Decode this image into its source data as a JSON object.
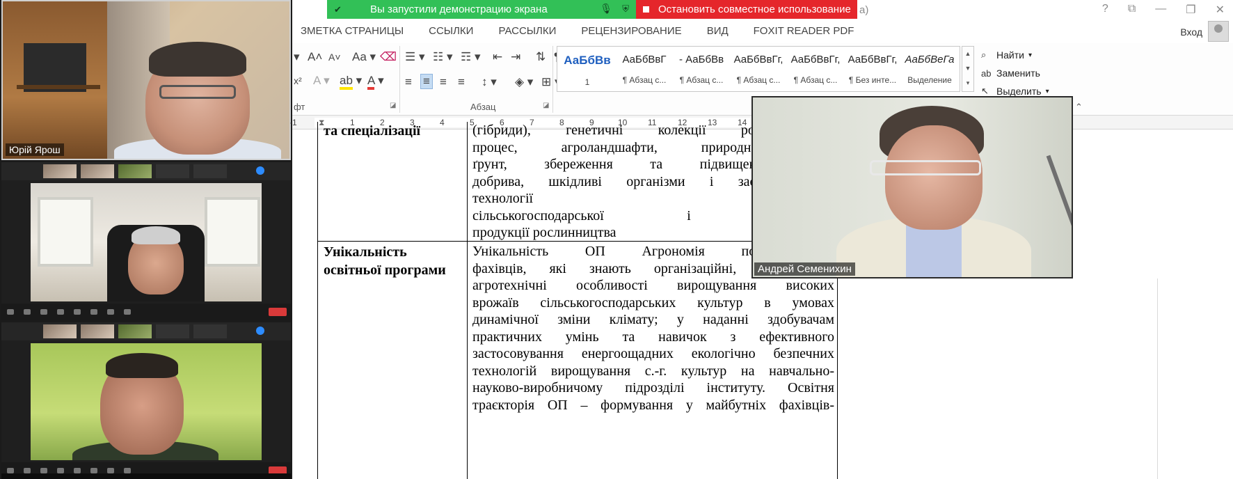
{
  "participants": {
    "tile1_name": "Юрій Ярош",
    "tile4_name": "Андрей Семенихин"
  },
  "share_bar": {
    "status": "Вы запустили демонстрацию экрана",
    "stop": "Остановить совместное использование",
    "title_fragment": "a)"
  },
  "window_controls": [
    "?",
    "⧉",
    "—",
    "❐",
    "✕"
  ],
  "tabs": [
    "ЗМЕТКА СТРАНИЦЫ",
    "ССЫЛКИ",
    "РАССЫЛКИ",
    "РЕЦЕНЗИРОВАНИЕ",
    "ВИД",
    "FOXIT READER PDF"
  ],
  "account": {
    "login": "Вход"
  },
  "ribbon": {
    "font_group_label": "фт",
    "paragraph_group_label": "Абзац",
    "styles_group_label": "С",
    "aa_label": "Aa",
    "pilcrow": "¶",
    "styles": [
      {
        "sample": "АаБбВв",
        "name": "1"
      },
      {
        "sample": "АаБбВвГ",
        "name": "¶ Абзац с..."
      },
      {
        "sample": "- АаБбВв",
        "name": "¶ Абзац с..."
      },
      {
        "sample": "АаБбВвГг,",
        "name": "¶ Абзац с..."
      },
      {
        "sample": "АаБбВвГг,",
        "name": "¶ Абзац с..."
      },
      {
        "sample": "АаБбВвГг,",
        "name": "¶ Без инте..."
      },
      {
        "sample": "АаБбВеГа",
        "name": "Выделение"
      }
    ],
    "editing": {
      "find": "Найти",
      "replace": "Заменить",
      "select": "Выделить"
    }
  },
  "ruler": [
    "1",
    "1",
    "2",
    "3",
    "4",
    "5",
    "6",
    "7",
    "8",
    "9",
    "10",
    "11",
    "12",
    "13",
    "14"
  ],
  "document": {
    "row1_head": "та спеціалізації",
    "row1_lines": [
      "(гібриди), генетичні колекції рослин, се",
      "процес, агроландшафти, природні кормо",
      "ґрунт, збереження та підвищення його",
      "добрива, шкідливі організми і засоби захис",
      "технології виробництва,",
      "сільськогосподарської і первинної",
      "продукції рослинництва"
    ],
    "row2_head_1": "Унікальність",
    "row2_head_2": "освітньої програми",
    "row2_lines": [
      "Унікальність ОП Агрономія полягає: у",
      "фахівців, які знають організаційні, технологічні",
      "агротехнічні особливості вирощування високих",
      "врожаїв сільськогосподарських культур в умовах",
      "динамічної зміни клімату; у наданні здобувачам",
      "практичних умінь та навичок з ефективного",
      "застосовування енергоощадних екологічно безпечних",
      "технологій вирощування с.-г. культур на навчально-",
      "науково-виробничому підрозділі інституту. Освітня",
      "траєкторія ОП – формування у майбутніх фахівців-"
    ]
  },
  "colors": {
    "share_green": "#32c057",
    "share_red": "#e5262b",
    "style_accent": "#1f5fbf"
  }
}
